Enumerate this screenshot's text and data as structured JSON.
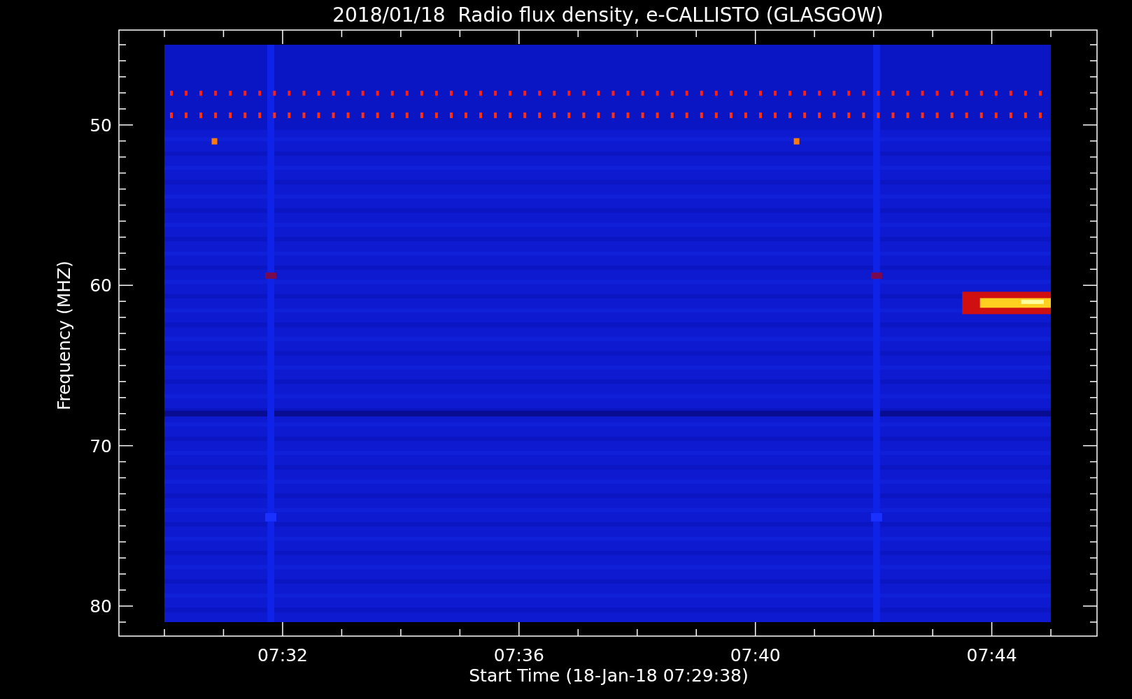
{
  "title": "2018/01/18  Radio flux density, e-CALLISTO (GLASGOW)",
  "y_axis": {
    "label": "Frequency (MHZ)",
    "ticks": [
      "50",
      "60",
      "70",
      "80"
    ]
  },
  "x_axis": {
    "label": "Start Time (18-Jan-18 07:29:38)",
    "ticks": [
      "07:32",
      "07:36",
      "07:40",
      "07:44"
    ]
  }
}
